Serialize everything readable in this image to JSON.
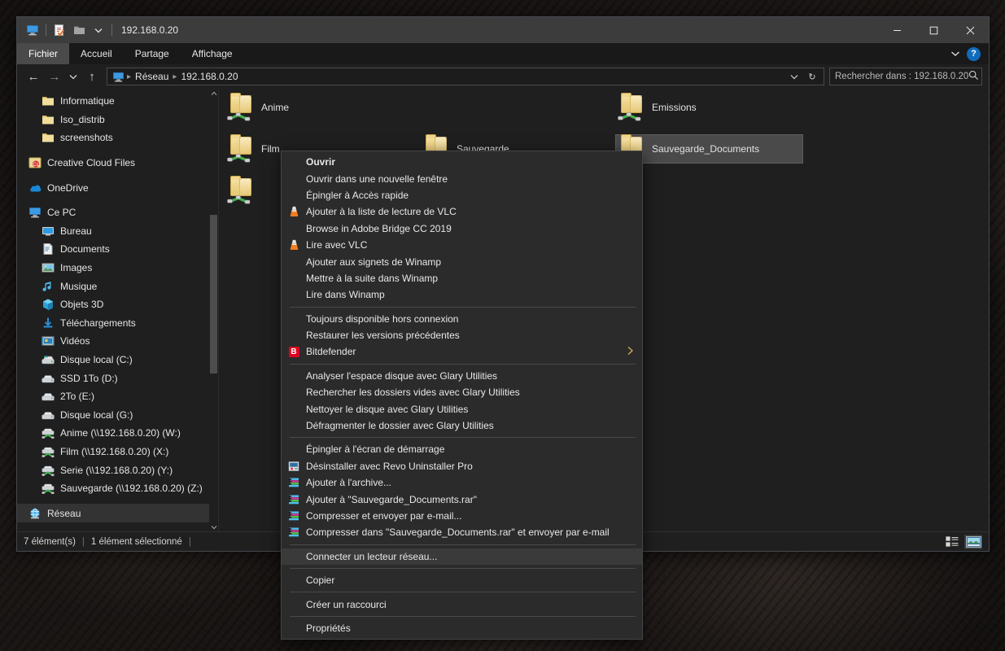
{
  "window": {
    "title": "192.168.0.20",
    "quick_access": [
      "this-pc-icon",
      "properties-icon",
      "new-folder-icon",
      "customize-dropdown-icon"
    ],
    "controls": {
      "minimize": "─",
      "maximize": "□",
      "close": "✕"
    }
  },
  "ribbon": {
    "tabs": [
      {
        "label": "Fichier",
        "active": true
      },
      {
        "label": "Accueil",
        "active": false
      },
      {
        "label": "Partage",
        "active": false
      },
      {
        "label": "Affichage",
        "active": false
      }
    ],
    "collapse_label": "⌄",
    "help_label": "?"
  },
  "navbar": {
    "back": "←",
    "forward": "→",
    "recent": "⌄",
    "up": "↑",
    "breadcrumbs": [
      "Réseau",
      "192.168.0.20"
    ],
    "dropdown": "⌄",
    "refresh": "↻"
  },
  "search": {
    "placeholder": "Rechercher dans : 192.168.0.20",
    "icon": "search-icon"
  },
  "sidebar": {
    "items": [
      {
        "label": "Informatique",
        "icon": "folder-icon",
        "indent": 2,
        "selected": false
      },
      {
        "label": "Iso_distrib",
        "icon": "folder-icon",
        "indent": 2,
        "selected": false
      },
      {
        "label": "screenshots",
        "icon": "folder-icon",
        "indent": 2,
        "selected": false
      },
      {
        "label": "Creative Cloud Files",
        "icon": "creative-cloud-icon",
        "indent": 1,
        "selected": false,
        "gap_before": true
      },
      {
        "label": "OneDrive",
        "icon": "onedrive-icon",
        "indent": 1,
        "selected": false,
        "gap_before": true
      },
      {
        "label": "Ce PC",
        "icon": "this-pc-icon",
        "indent": 1,
        "selected": false,
        "gap_before": true
      },
      {
        "label": "Bureau",
        "icon": "desktop-icon",
        "indent": 2,
        "selected": false
      },
      {
        "label": "Documents",
        "icon": "documents-icon",
        "indent": 2,
        "selected": false
      },
      {
        "label": "Images",
        "icon": "pictures-icon",
        "indent": 2,
        "selected": false
      },
      {
        "label": "Musique",
        "icon": "music-icon",
        "indent": 2,
        "selected": false
      },
      {
        "label": "Objets 3D",
        "icon": "3d-objects-icon",
        "indent": 2,
        "selected": false
      },
      {
        "label": "Téléchargements",
        "icon": "downloads-icon",
        "indent": 2,
        "selected": false
      },
      {
        "label": "Vidéos",
        "icon": "videos-icon",
        "indent": 2,
        "selected": false
      },
      {
        "label": "Disque local (C:)",
        "icon": "system-drive-icon",
        "indent": 2,
        "selected": false
      },
      {
        "label": "SSD 1To (D:)",
        "icon": "drive-icon",
        "indent": 2,
        "selected": false
      },
      {
        "label": "2To (E:)",
        "icon": "drive-icon",
        "indent": 2,
        "selected": false
      },
      {
        "label": "Disque local (G:)",
        "icon": "drive-icon",
        "indent": 2,
        "selected": false
      },
      {
        "label": "Anime (\\\\192.168.0.20) (W:)",
        "icon": "network-drive-icon",
        "indent": 2,
        "selected": false
      },
      {
        "label": "Film (\\\\192.168.0.20) (X:)",
        "icon": "network-drive-icon",
        "indent": 2,
        "selected": false
      },
      {
        "label": "Serie (\\\\192.168.0.20) (Y:)",
        "icon": "network-drive-icon",
        "indent": 2,
        "selected": false
      },
      {
        "label": "Sauvegarde (\\\\192.168.0.20) (Z:)",
        "icon": "network-drive-icon",
        "indent": 2,
        "selected": false
      },
      {
        "label": "Réseau",
        "icon": "network-icon",
        "indent": 1,
        "selected": true,
        "gap_before": true
      }
    ]
  },
  "files": [
    {
      "label": "Anime",
      "icon": "network-share-folder-icon",
      "selected": false
    },
    {
      "label": "Emissions",
      "icon": "network-share-folder-icon",
      "selected": false
    },
    {
      "label": "Film",
      "icon": "network-share-folder-icon",
      "selected": false
    },
    {
      "label": "Sauvegarde",
      "icon": "network-share-folder-icon",
      "selected": false
    },
    {
      "label": "Sauvegarde_Documents",
      "icon": "network-share-folder-icon",
      "selected": true
    },
    {
      "label": "",
      "icon": "network-share-folder-icon",
      "selected": false
    }
  ],
  "context_menu": {
    "groups": [
      {
        "items": [
          {
            "label": "Ouvrir",
            "icon": null,
            "bold": true,
            "submenu": false,
            "highlight": false
          },
          {
            "label": "Ouvrir dans une nouvelle fenêtre",
            "icon": null,
            "bold": false,
            "submenu": false,
            "highlight": false
          },
          {
            "label": "Épingler à Accès rapide",
            "icon": null,
            "bold": false,
            "submenu": false,
            "highlight": false
          },
          {
            "label": "Ajouter à la liste de lecture de VLC",
            "icon": "vlc-icon",
            "bold": false,
            "submenu": false,
            "highlight": false
          },
          {
            "label": "Browse in Adobe Bridge CC 2019",
            "icon": null,
            "bold": false,
            "submenu": false,
            "highlight": false
          },
          {
            "label": "Lire avec VLC",
            "icon": "vlc-icon",
            "bold": false,
            "submenu": false,
            "highlight": false
          },
          {
            "label": "Ajouter aux signets de Winamp",
            "icon": null,
            "bold": false,
            "submenu": false,
            "highlight": false
          },
          {
            "label": "Mettre à la suite dans Winamp",
            "icon": null,
            "bold": false,
            "submenu": false,
            "highlight": false
          },
          {
            "label": "Lire dans Winamp",
            "icon": null,
            "bold": false,
            "submenu": false,
            "highlight": false
          }
        ]
      },
      {
        "items": [
          {
            "label": "Toujours disponible hors connexion",
            "icon": null,
            "bold": false,
            "submenu": false,
            "highlight": false
          },
          {
            "label": "Restaurer les versions précédentes",
            "icon": null,
            "bold": false,
            "submenu": false,
            "highlight": false
          },
          {
            "label": "Bitdefender",
            "icon": "bitdefender-icon",
            "bold": false,
            "submenu": true,
            "highlight": false
          }
        ]
      },
      {
        "items": [
          {
            "label": "Analyser l'espace disque avec Glary Utilities",
            "icon": null,
            "bold": false,
            "submenu": false,
            "highlight": false
          },
          {
            "label": "Rechercher les dossiers vides avec Glary Utilities",
            "icon": null,
            "bold": false,
            "submenu": false,
            "highlight": false
          },
          {
            "label": "Nettoyer le disque avec Glary Utilities",
            "icon": null,
            "bold": false,
            "submenu": false,
            "highlight": false
          },
          {
            "label": "Défragmenter le dossier avec Glary Utilities",
            "icon": null,
            "bold": false,
            "submenu": false,
            "highlight": false
          }
        ]
      },
      {
        "items": [
          {
            "label": "Épingler à l'écran de démarrage",
            "icon": null,
            "bold": false,
            "submenu": false,
            "highlight": false
          },
          {
            "label": "Désinstaller avec Revo Uninstaller Pro",
            "icon": "revo-icon",
            "bold": false,
            "submenu": false,
            "highlight": false
          },
          {
            "label": "Ajouter à l'archive...",
            "icon": "winrar-icon",
            "bold": false,
            "submenu": false,
            "highlight": false
          },
          {
            "label": "Ajouter à \"Sauvegarde_Documents.rar\"",
            "icon": "winrar-icon",
            "bold": false,
            "submenu": false,
            "highlight": false
          },
          {
            "label": "Compresser et envoyer par e-mail...",
            "icon": "winrar-icon",
            "bold": false,
            "submenu": false,
            "highlight": false
          },
          {
            "label": "Compresser dans \"Sauvegarde_Documents.rar\" et envoyer par e-mail",
            "icon": "winrar-icon",
            "bold": false,
            "submenu": false,
            "highlight": false
          }
        ]
      },
      {
        "items": [
          {
            "label": "Connecter un lecteur réseau...",
            "icon": null,
            "bold": false,
            "submenu": false,
            "highlight": true
          }
        ]
      },
      {
        "items": [
          {
            "label": "Copier",
            "icon": null,
            "bold": false,
            "submenu": false,
            "highlight": false
          }
        ]
      },
      {
        "items": [
          {
            "label": "Créer un raccourci",
            "icon": null,
            "bold": false,
            "submenu": false,
            "highlight": false
          }
        ]
      },
      {
        "items": [
          {
            "label": "Propriétés",
            "icon": null,
            "bold": false,
            "submenu": false,
            "highlight": false
          }
        ]
      }
    ]
  },
  "statusbar": {
    "item_count": "7 élément(s)",
    "selection": "1 élément sélectionné",
    "views": [
      {
        "name": "details-view-button",
        "active": false
      },
      {
        "name": "large-icons-view-button",
        "active": true
      }
    ]
  },
  "colors": {
    "window_bg": "#1f1f1f",
    "titlebar_bg": "#3c3c3c",
    "menu_bg": "#2b2b2b",
    "accent_blue": "#0f6cbd",
    "selection": "#4a4a4a",
    "folder_yellow": "#edd287",
    "network_green": "#3fb24a",
    "bitdefender_red": "#e00020"
  }
}
